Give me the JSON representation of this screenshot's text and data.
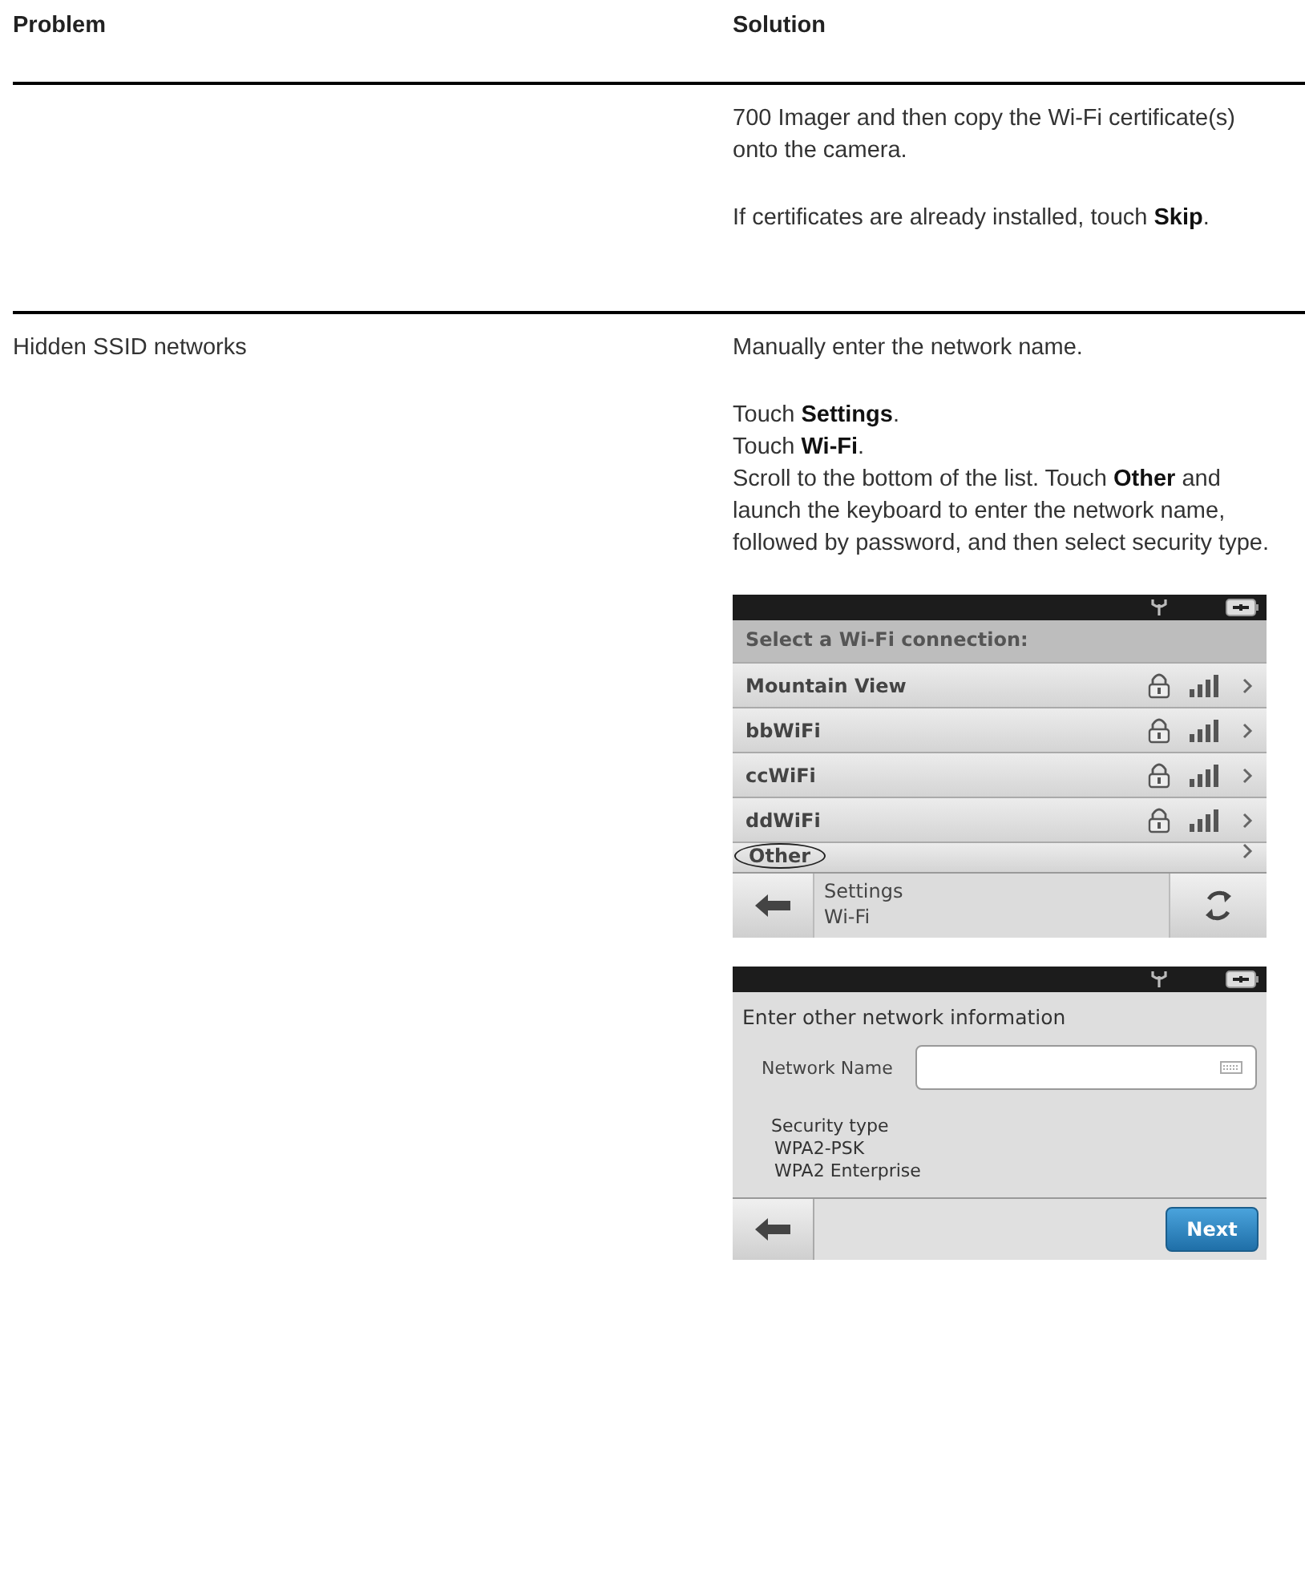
{
  "table": {
    "columns": [
      "Problem",
      "Solution"
    ],
    "rows": [
      {
        "problem": "",
        "solution": [
          "700 Imager and then copy the Wi-Fi certificate(s) onto the camera.",
          "If certificates are already installed, touch **Skip**."
        ]
      },
      {
        "problem": "Hidden SSID networks",
        "solution": [
          "Manually enter the network name.",
          "Touch **Settings**.\nTouch **Wi-Fi**.\nScroll to the bottom of the list. Touch **Other** and launch the keyboard to enter the network name, followed by password, and then select security type."
        ]
      }
    ]
  },
  "wifi_screen": {
    "header": "Select a Wi-Fi connection:",
    "networks": [
      {
        "name": "Mountain View",
        "locked": true
      },
      {
        "name": "bbWiFi",
        "locked": true
      },
      {
        "name": "ccWiFi",
        "locked": true
      },
      {
        "name": "ddWiFi",
        "locked": true
      },
      {
        "name": "Other",
        "locked": false
      }
    ],
    "breadcrumb": [
      "Settings",
      "Wi-Fi"
    ]
  },
  "network_screen": {
    "title": "Enter other network information",
    "field_label": "Network Name",
    "security_label": "Security type",
    "security_options": [
      "WPA2-PSK",
      "WPA2 Enterprise"
    ],
    "next_button": "Next"
  }
}
